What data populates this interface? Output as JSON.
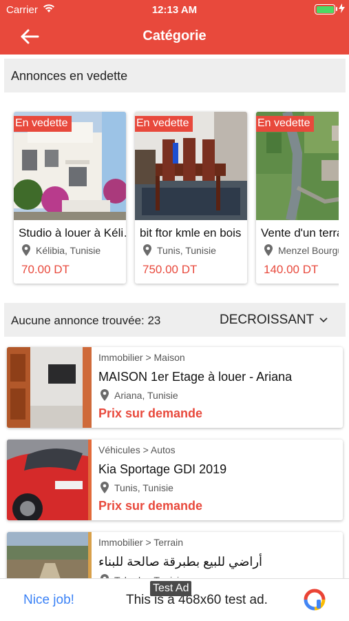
{
  "status_bar": {
    "carrier": "Carrier",
    "time": "12:13 AM"
  },
  "nav": {
    "title": "Catégorie",
    "back_icon": "arrow-left-icon"
  },
  "featured": {
    "heading": "Annonces en vedette",
    "items": [
      {
        "badge": "En vedette",
        "title": "Studio à louer à Kélibia",
        "location": "Kélibia, Tunisie",
        "price": "70.00 DT"
      },
      {
        "badge": "En vedette",
        "title": "bit ftor kmle en bois",
        "location": "Tunis, Tunisie",
        "price": "750.00 DT"
      },
      {
        "badge": "En vedette",
        "title": "Vente d'un terrain",
        "location": "Menzel Bourguiba",
        "price": "140.00 DT"
      }
    ]
  },
  "results": {
    "count_label": "Aucune annonce trouvée: 23",
    "sort_value": "DECROISSANT"
  },
  "listings": [
    {
      "category": "Immobilier > Maison",
      "title": "MAISON 1er Etage à louer - Ariana",
      "location": "Ariana, Tunisie",
      "price": "Prix sur demande"
    },
    {
      "category": "Véhicules > Autos",
      "title": "Kia Sportage GDI 2019",
      "location": "Tunis, Tunisie",
      "price": "Prix sur demande"
    },
    {
      "category": "Immobilier > Terrain",
      "title": "أراضي للبيع بطبرقة صالحة للبناء",
      "location": "Tabarka, Tunisie",
      "price": ""
    }
  ],
  "ad": {
    "tag": "Test Ad",
    "nice": "Nice job!",
    "text": "This is a 468x60 test ad."
  },
  "colors": {
    "accent": "#e8493c",
    "badge": "#e8493c",
    "price": "#e8493c",
    "section_bg": "#eeeeee"
  }
}
